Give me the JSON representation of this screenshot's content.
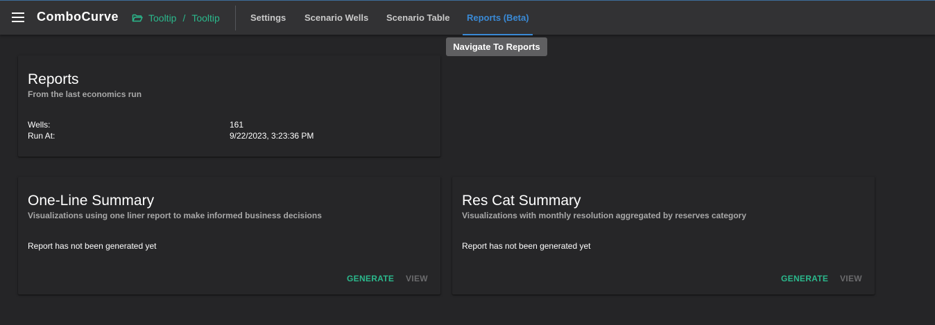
{
  "app": {
    "brand": "ComboCurve",
    "breadcrumb": [
      "Tooltip",
      "Tooltip"
    ],
    "breadcrumb_separator": "/"
  },
  "nav": {
    "tabs": [
      {
        "label": "Settings",
        "active": false
      },
      {
        "label": "Scenario Wells",
        "active": false
      },
      {
        "label": "Scenario Table",
        "active": false
      },
      {
        "label": "Reports (Beta)",
        "active": true
      }
    ],
    "tooltip": "Navigate To Reports"
  },
  "reports_card": {
    "title": "Reports",
    "subtitle": "From the last economics run",
    "rows": [
      {
        "label": "Wells:",
        "value": "161"
      },
      {
        "label": "Run At:",
        "value": "9/22/2023, 3:23:36 PM"
      }
    ]
  },
  "summaries": [
    {
      "title": "One-Line Summary",
      "subtitle": "Visualizations using one liner report to make informed business decisions",
      "status": "Report has not been generated yet",
      "generate_label": "GENERATE",
      "view_label": "VIEW"
    },
    {
      "title": "Res Cat Summary",
      "subtitle": "Visualizations with monthly resolution aggregated by reserves category",
      "status": "Report has not been generated yet",
      "generate_label": "GENERATE",
      "view_label": "VIEW"
    }
  ],
  "colors": {
    "accent_blue": "#3a8ad6",
    "accent_green": "#2bb88c",
    "background": "#252527",
    "topbar": "#323234"
  }
}
